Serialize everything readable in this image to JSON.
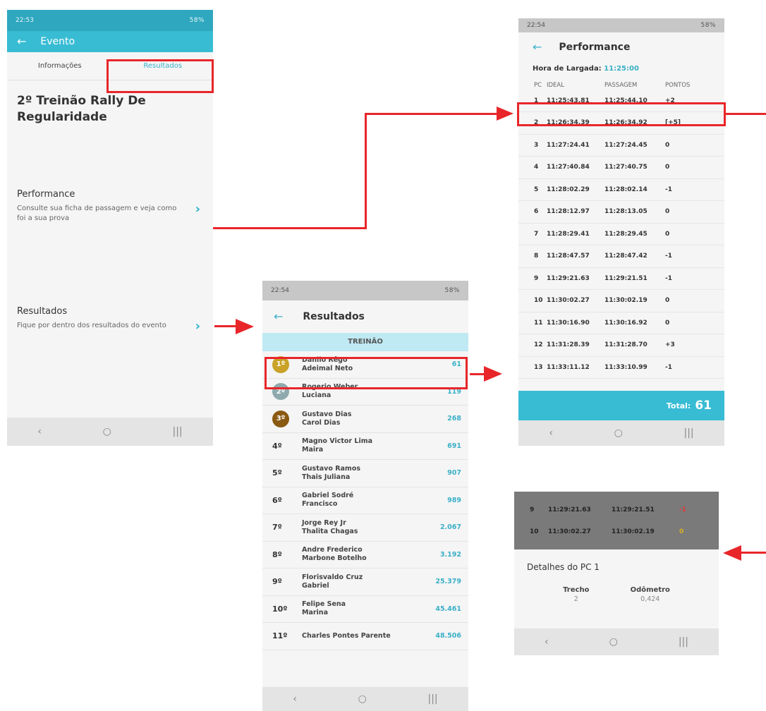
{
  "status": {
    "time1": "22:53",
    "time2": "22:54",
    "right": "58%"
  },
  "evento": {
    "title": "Evento",
    "tabs": [
      "Informações",
      "Resultados"
    ],
    "event_name": "2º Treinão Rally De Regularidade",
    "items": [
      {
        "title": "Performance",
        "desc": "Consulte sua ficha de passagem e veja como foi a sua prova"
      },
      {
        "title": "Resultados",
        "desc": "Fique por dentro dos resultados do evento"
      }
    ]
  },
  "performance": {
    "title": "Performance",
    "start_label": "Hora de Largada:",
    "start_value": "11:25:00",
    "headers": [
      "PC",
      "IDEAL",
      "PASSAGEM",
      "PONTOS"
    ],
    "rows": [
      {
        "pc": "1",
        "ideal": "11:25:43.81",
        "pass": "11:25:44.10",
        "pts": "+2",
        "kind": "pos"
      },
      {
        "pc": "2",
        "ideal": "11:26:34.39",
        "pass": "11:26:34.92",
        "pts": "[+5]",
        "kind": "pos"
      },
      {
        "pc": "3",
        "ideal": "11:27:24.41",
        "pass": "11:27:24.45",
        "pts": "0",
        "kind": "zero"
      },
      {
        "pc": "4",
        "ideal": "11:27:40.84",
        "pass": "11:27:40.75",
        "pts": "0",
        "kind": "zero"
      },
      {
        "pc": "5",
        "ideal": "11:28:02.29",
        "pass": "11:28:02.14",
        "pts": "-1",
        "kind": "neg"
      },
      {
        "pc": "6",
        "ideal": "11:28:12.97",
        "pass": "11:28:13.05",
        "pts": "0",
        "kind": "zero"
      },
      {
        "pc": "7",
        "ideal": "11:28:29.41",
        "pass": "11:28:29.45",
        "pts": "0",
        "kind": "zero"
      },
      {
        "pc": "8",
        "ideal": "11:28:47.57",
        "pass": "11:28:47.42",
        "pts": "-1",
        "kind": "neg"
      },
      {
        "pc": "9",
        "ideal": "11:29:21.63",
        "pass": "11:29:21.51",
        "pts": "-1",
        "kind": "neg"
      },
      {
        "pc": "10",
        "ideal": "11:30:02.27",
        "pass": "11:30:02.19",
        "pts": "0",
        "kind": "zero"
      },
      {
        "pc": "11",
        "ideal": "11:30:16.90",
        "pass": "11:30:16.92",
        "pts": "0",
        "kind": "zero"
      },
      {
        "pc": "12",
        "ideal": "11:31:28.39",
        "pass": "11:31:28.70",
        "pts": "+3",
        "kind": "pos"
      },
      {
        "pc": "13",
        "ideal": "11:33:11.12",
        "pass": "11:33:10.99",
        "pts": "-1",
        "kind": "neg"
      }
    ],
    "total_label": "Total:",
    "total_value": "61"
  },
  "resultados": {
    "title": "Resultados",
    "band": "TREINÃO",
    "rows": [
      {
        "pos": "1º",
        "names": [
          "Danilo Rêgo",
          "Adeimal Neto"
        ],
        "score": "61",
        "medal": "#c9a227"
      },
      {
        "pos": "2º",
        "names": [
          "Rogerio Weber",
          "Luciana"
        ],
        "score": "119",
        "medal": "#8fa9ad"
      },
      {
        "pos": "3º",
        "names": [
          "Gustavo Dias",
          "Carol Dias"
        ],
        "score": "268",
        "medal": "#8a5a12"
      },
      {
        "pos": "4º",
        "names": [
          "Magno Victor Lima",
          "Maira"
        ],
        "score": "691"
      },
      {
        "pos": "5º",
        "names": [
          "Gustavo Ramos",
          "Thais Juliana"
        ],
        "score": "907"
      },
      {
        "pos": "6º",
        "names": [
          "Gabriel Sodré",
          "Francisco"
        ],
        "score": "989"
      },
      {
        "pos": "7º",
        "names": [
          "Jorge Rey Jr",
          "Thalita Chagas"
        ],
        "score": "2.067"
      },
      {
        "pos": "8º",
        "names": [
          "Andre Frederico",
          "Marbone Botelho"
        ],
        "score": "3.192"
      },
      {
        "pos": "9º",
        "names": [
          "Florisvaldo Cruz",
          "Gabriel"
        ],
        "score": "25.379"
      },
      {
        "pos": "10º",
        "names": [
          "Felipe Sena",
          "Marina"
        ],
        "score": "45.461"
      },
      {
        "pos": "11º",
        "names": [
          "Charles Pontes Parente",
          ""
        ],
        "score": "48.506"
      }
    ]
  },
  "detalhes": {
    "dim_rows": [
      {
        "pc": "9",
        "ideal": "11:29:21.63",
        "pass": "11:29:21.51",
        "pts": "-1",
        "kind": "neg"
      },
      {
        "pc": "10",
        "ideal": "11:30:02.27",
        "pass": "11:30:02.19",
        "pts": "0",
        "kind": "zero"
      }
    ],
    "title": "Detalhes do PC 1",
    "trecho_label": "Trecho",
    "trecho_value": "2",
    "odometro_label": "Odômetro",
    "odometro_value": "0,424"
  },
  "nav": {
    "back": "‹",
    "home": "○",
    "recent": "|||"
  },
  "colors": {
    "accent": "#38bcd4",
    "highlight": "#e8262a"
  }
}
